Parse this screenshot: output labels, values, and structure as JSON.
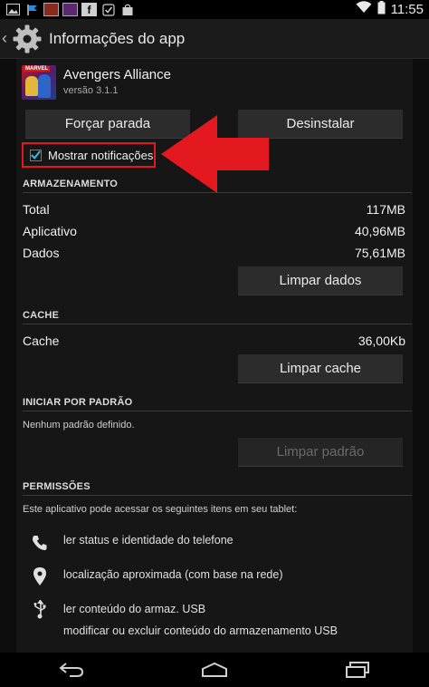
{
  "status_bar": {
    "time": "11:55",
    "icons": [
      "image-icon",
      "flag-icon",
      "image-icon",
      "image-icon",
      "facebook-icon",
      "check-icon",
      "bag-icon",
      "wifi-icon",
      "battery-icon"
    ]
  },
  "action_bar": {
    "title": "Informações do app"
  },
  "app": {
    "name": "Avengers Alliance",
    "version": "versão 3.1.1",
    "icon_badge": "MARVEL"
  },
  "buttons": {
    "force_stop": "Forçar parada",
    "uninstall": "Desinstalar",
    "clear_data": "Limpar dados",
    "clear_cache": "Limpar cache",
    "clear_defaults": "Limpar padrão"
  },
  "notifications": {
    "label": "Mostrar notificações",
    "checked": true
  },
  "storage": {
    "title": "ARMAZENAMENTO",
    "rows": [
      {
        "label": "Total",
        "value": "117MB"
      },
      {
        "label": "Aplicativo",
        "value": "40,96MB"
      },
      {
        "label": "Dados",
        "value": "75,61MB"
      }
    ]
  },
  "cache": {
    "title": "CACHE",
    "label": "Cache",
    "value": "36,00Kb"
  },
  "defaults": {
    "title": "INICIAR POR PADRÃO",
    "text": "Nenhum padrão definido."
  },
  "permissions": {
    "title": "PERMISSÕES",
    "intro": "Este aplicativo pode acessar os seguintes itens em seu tablet:",
    "items": [
      {
        "icon": "phone-icon",
        "text": "ler status e identidade do telefone"
      },
      {
        "icon": "location-icon",
        "text": "localização aproximada (com base na rede)"
      },
      {
        "icon": "usb-icon",
        "text": "ler conteúdo do armaz. USB"
      },
      {
        "icon": "usb-icon",
        "text": "modificar ou excluir conteúdo do armazenamento USB"
      }
    ]
  },
  "colors": {
    "accent": "#33b5e5",
    "highlight": "#e3191f"
  }
}
